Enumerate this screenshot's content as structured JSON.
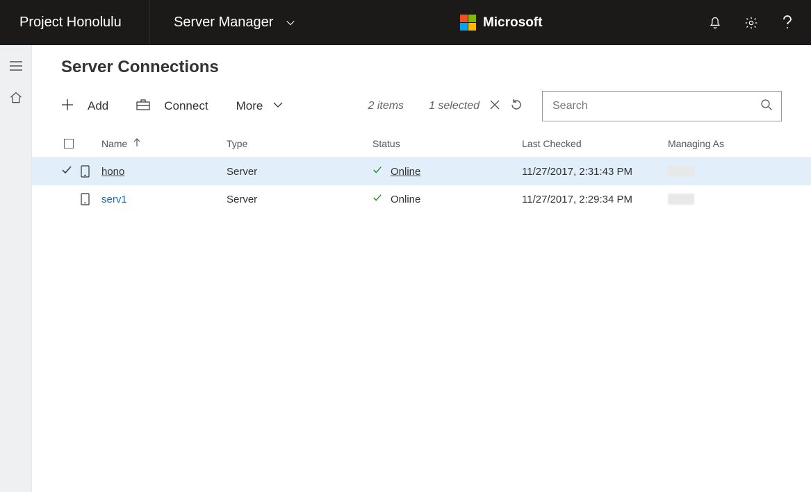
{
  "topbar": {
    "brand": "Project Honolulu",
    "section": "Server Manager",
    "logo_text": "Microsoft"
  },
  "page": {
    "title": "Server Connections"
  },
  "toolbar": {
    "add": "Add",
    "connect": "Connect",
    "more": "More",
    "items_count": "2 items",
    "selected_count": "1 selected",
    "search_placeholder": "Search"
  },
  "columns": {
    "name": "Name",
    "type": "Type",
    "status": "Status",
    "last_checked": "Last Checked",
    "managing_as": "Managing As"
  },
  "rows": [
    {
      "selected": true,
      "name": "hono",
      "type": "Server",
      "status": "Online",
      "last_checked": "11/27/2017, 2:31:43 PM",
      "managing_as": ""
    },
    {
      "selected": false,
      "name": "serv1",
      "type": "Server",
      "status": "Online",
      "last_checked": "11/27/2017, 2:29:34 PM",
      "managing_as": ""
    }
  ]
}
